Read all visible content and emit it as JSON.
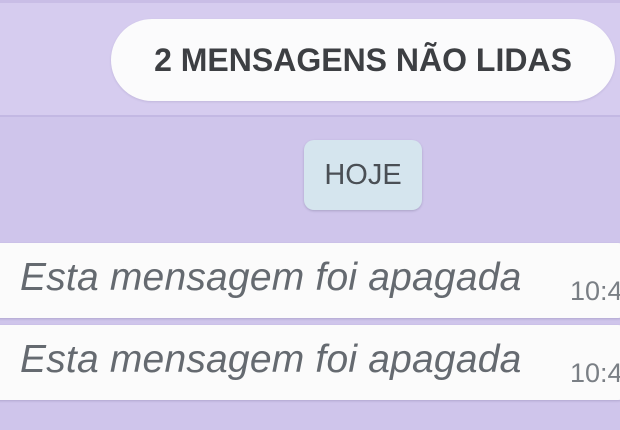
{
  "chat": {
    "unread_banner": "2 MENSAGENS NÃO LIDAS",
    "date_divider": "HOJE",
    "messages": [
      {
        "text": "Esta mensagem foi apagada",
        "time": "10:4",
        "icon": "deleted-message-icon"
      },
      {
        "text": "Esta mensagem foi apagada",
        "time": "10:4",
        "icon": "deleted-message-icon"
      }
    ]
  },
  "colors": {
    "wallpaper": "#cfc5eb",
    "banner_background": "#fbfbfc",
    "date_chip_background": "#d5e5ee",
    "message_bubble": "#fbfbfb",
    "deleted_text": "#656a70"
  }
}
